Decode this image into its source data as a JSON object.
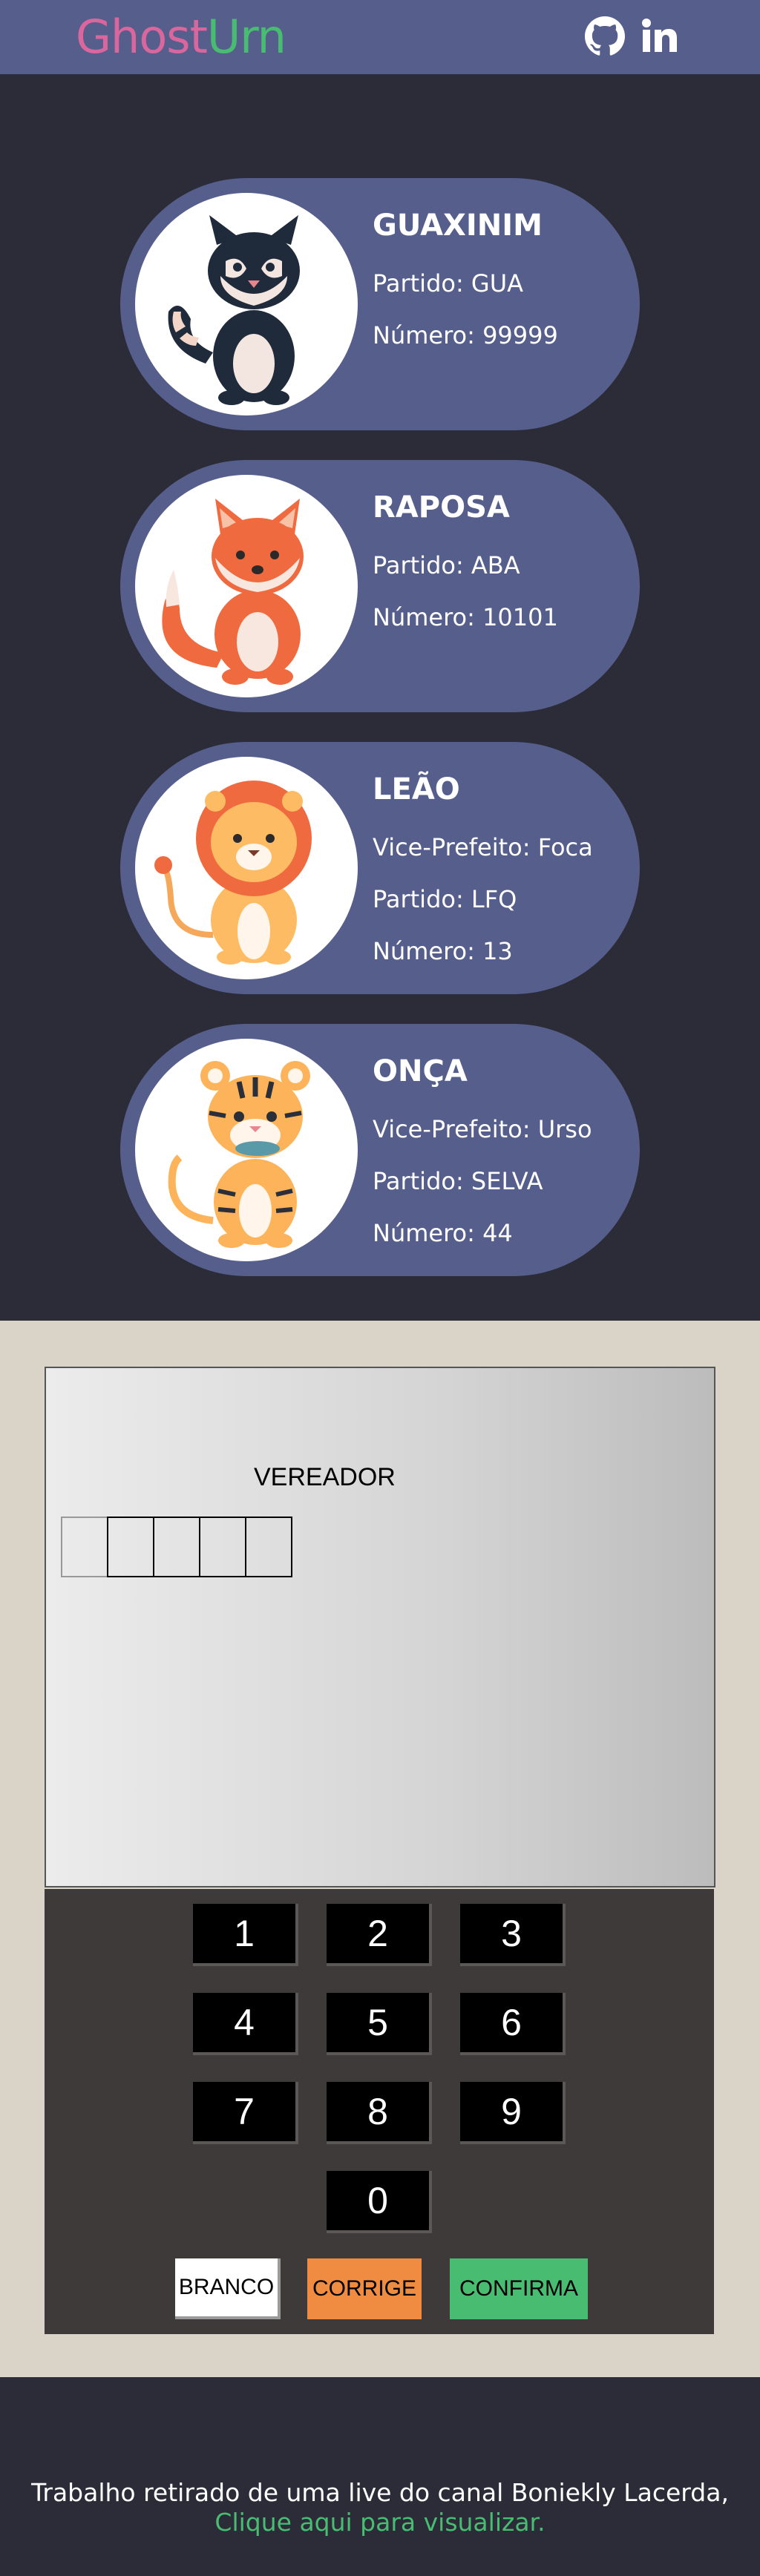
{
  "header": {
    "logo_part1": "Ghost",
    "logo_part2": "Urn",
    "logo_colors": {
      "ghost": "#d9679e",
      "urn": "#48bd72"
    },
    "icons": [
      "github-icon",
      "linkedin-icon"
    ]
  },
  "candidates": [
    {
      "name": "GUAXINIM",
      "lines": [
        "Partido: GUA",
        "Número: 99999"
      ],
      "icon": "raccoon-icon"
    },
    {
      "name": "RAPOSA",
      "lines": [
        "Partido: ABA",
        "Número: 10101"
      ],
      "icon": "fox-icon"
    },
    {
      "name": "LEÃO",
      "lines": [
        "Vice-Prefeito: Foca",
        "Partido: LFQ",
        "Número: 13"
      ],
      "icon": "lion-icon"
    },
    {
      "name": "ONÇA",
      "lines": [
        "Vice-Prefeito: Urso",
        "Partido: SELVA",
        "Número: 44"
      ],
      "icon": "jaguar-icon"
    }
  ],
  "machine": {
    "role": "VEREADOR",
    "keys": [
      "1",
      "2",
      "3",
      "4",
      "5",
      "6",
      "7",
      "8",
      "9",
      "0"
    ],
    "branco": "BRANCO",
    "corrige": "CORRIGE",
    "confirma": "CONFIRMA",
    "colors": {
      "corrige": "#ef8c42",
      "confirma": "#48bd72"
    }
  },
  "footer": {
    "text": "Trabalho retirado de uma live do canal Boniekly Lacerda,",
    "link": "Clique aqui para visualizar."
  }
}
